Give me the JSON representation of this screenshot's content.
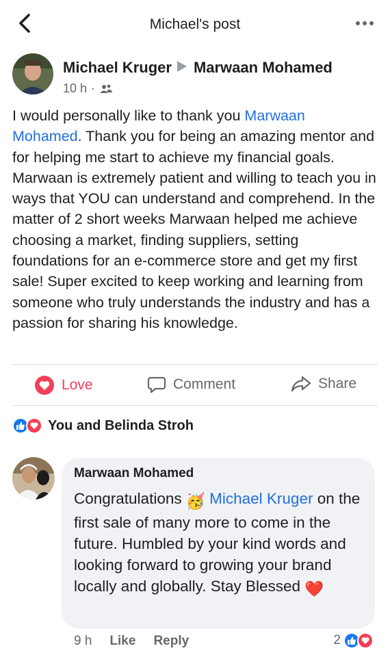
{
  "header": {
    "title": "Michael's post",
    "back_icon": "chevron-left-icon",
    "more_icon": "more-horizontal-icon"
  },
  "post": {
    "author": "Michael Kruger",
    "target": "Marwaan Mohamed",
    "time": "10 h",
    "audience_icon": "friends-icon",
    "body": {
      "intro": "I would personally like to thank you ",
      "mention": "Marwaan Mohamed",
      "rest": ". Thank you for being an amazing mentor and for helping me start to achieve my financial goals. Marwaan is extremely patient and willing to teach you in ways that YOU can understand and comprehend. In the matter of 2 short weeks Marwaan helped me achieve choosing a market, finding suppliers, setting foundations for an e-commerce store and get my first sale! Super excited to keep working and learning from someone who truly understands the industry and has a passion for sharing his knowledge."
    }
  },
  "actions": {
    "love_label": "Love",
    "comment_label": "Comment",
    "share_label": "Share"
  },
  "reactions": {
    "text": "You and Belinda Stroh",
    "icons": [
      "like-icon",
      "love-icon"
    ]
  },
  "comment": {
    "author": "Marwaan Mohamed",
    "text_before": "Congratulations ",
    "emoji_1": "🥳",
    "mention": "Michael Kruger",
    "text_after": " on the first sale of many more to come in the future. Humbled by your kind words and looking forward to growing your brand locally and globally. Stay Blessed ",
    "emoji_2": "❤️",
    "time": "9 h",
    "like_label": "Like",
    "reply_label": "Reply",
    "reaction_count": "2"
  },
  "colors": {
    "mention": "#216fdb",
    "love": "#f33e58",
    "like": "#1877f2",
    "muted": "#65676b",
    "bubble": "#f0f2f5"
  }
}
